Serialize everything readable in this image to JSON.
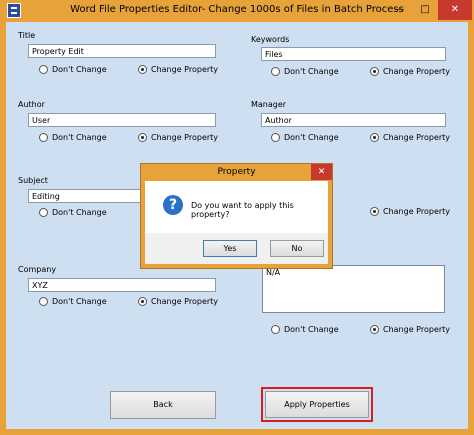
{
  "window": {
    "title": "Word File Properties Editor- Change 1000s of Files in Batch Process",
    "minimize": "—",
    "maximize": "□",
    "close": "✕"
  },
  "radio_options": {
    "dont_change": "Don't Change",
    "change_property": "Change Property"
  },
  "fields": {
    "title": {
      "label": "Title",
      "value": "Property Edit",
      "selected": "change_property"
    },
    "keywords": {
      "label": "Keywords",
      "value": "Files",
      "selected": "change_property"
    },
    "author": {
      "label": "Author",
      "value": "User",
      "selected": "change_property"
    },
    "manager": {
      "label": "Manager",
      "value": "Author",
      "selected": "change_property"
    },
    "subject": {
      "label": "Subject",
      "value": "Editing",
      "selected": "change_property"
    },
    "category": {
      "selected": "change_property"
    },
    "company": {
      "label": "Company",
      "value": "XYZ",
      "selected": "change_property"
    },
    "comments": {
      "value": "N/A",
      "selected": "change_property"
    }
  },
  "buttons": {
    "back": "Back",
    "apply": "Apply Properties"
  },
  "dialog": {
    "title": "Property",
    "close": "✕",
    "icon": "question-icon",
    "message": "Do you want to apply this property?",
    "yes": "Yes",
    "no": "No"
  },
  "colors": {
    "titlebar": "#E8A23A",
    "client_bg": "#CFDFF2",
    "close_red": "#C7392D",
    "highlight": "#D62020"
  }
}
